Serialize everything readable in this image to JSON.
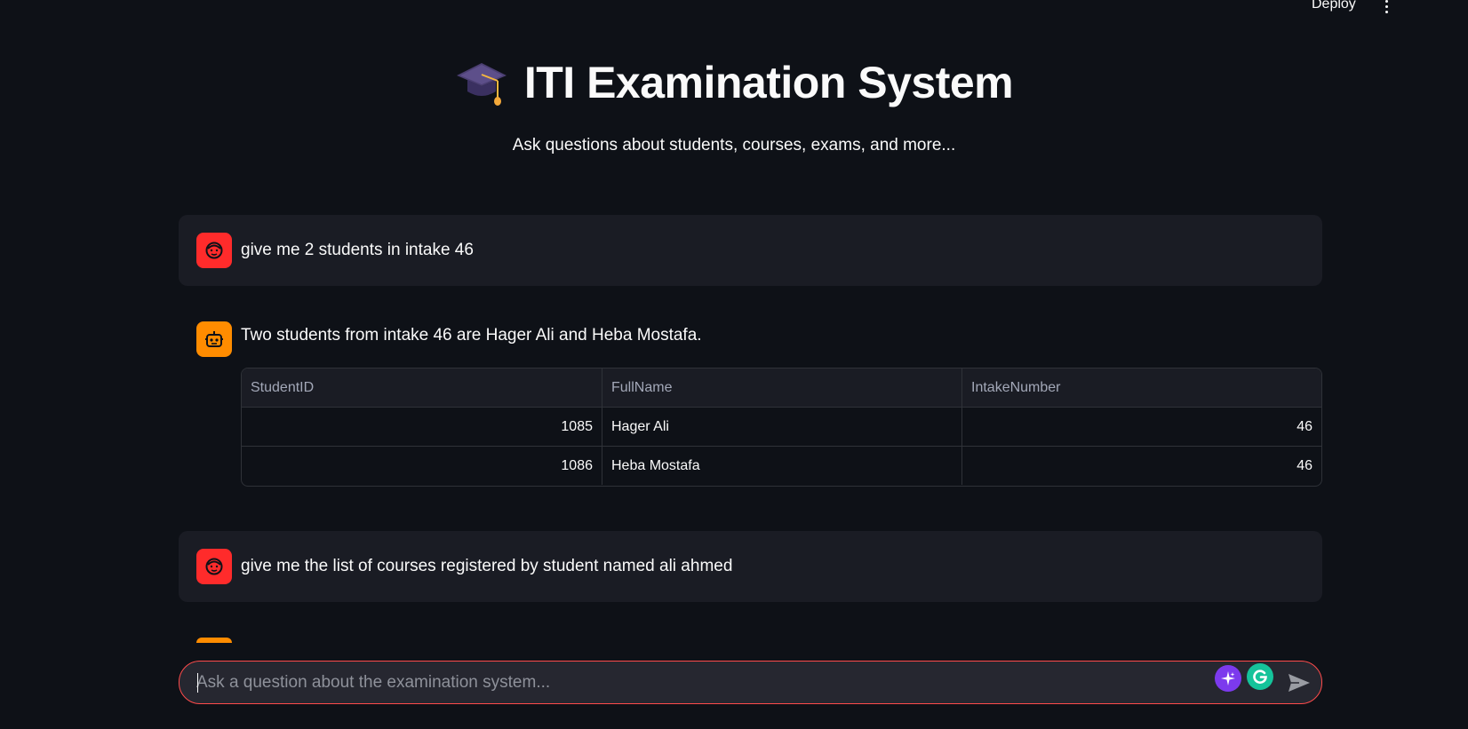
{
  "header": {
    "deploy_label": "Deploy",
    "menu_icon": "more-vertical-icon"
  },
  "hero": {
    "icon": "graduation-cap-icon",
    "title": "ITI Examination System",
    "subtitle": "Ask questions about students, courses, exams, and more..."
  },
  "messages": [
    {
      "role": "user",
      "avatar_icon": "user-face-icon",
      "text": "give me 2 students in intake 46"
    },
    {
      "role": "assistant",
      "avatar_icon": "robot-icon",
      "text": "Two students from intake 46 are Hager Ali and Heba Mostafa.",
      "table": {
        "columns": [
          "StudentID",
          "FullName",
          "IntakeNumber"
        ],
        "rows": [
          [
            "1085",
            "Hager Ali",
            "46"
          ],
          [
            "1086",
            "Heba Mostafa",
            "46"
          ]
        ]
      }
    },
    {
      "role": "user",
      "avatar_icon": "user-face-icon",
      "text": "give me the list of courses registered by student named ali ahmed"
    }
  ],
  "chat_input": {
    "placeholder": "Ask a question about the examination system...",
    "value": "",
    "send_icon": "send-icon",
    "extension_icons": [
      "sparkle-icon",
      "grammarly-icon"
    ]
  },
  "colors": {
    "background": "#0e1117",
    "user_avatar": "#ff2b2b",
    "bot_avatar": "#ff8c00",
    "input_border": "#ff4b4b"
  }
}
